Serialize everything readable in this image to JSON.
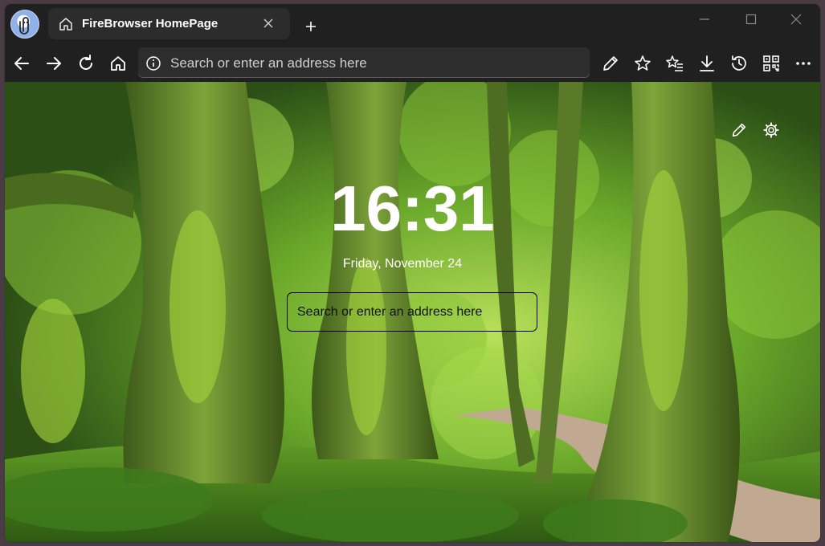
{
  "tab": {
    "title": "FireBrowser HomePage"
  },
  "address_bar": {
    "placeholder": "Search or enter an address here"
  },
  "homepage": {
    "time": "16:31",
    "date": "Friday, November 24",
    "search_placeholder": "Search or enter an address here",
    "background": "moss-covered forest trees with a dirt path"
  },
  "icons": {
    "nav": [
      "back-icon",
      "forward-icon",
      "refresh-icon",
      "home-icon"
    ],
    "toolbar": [
      "pen-icon",
      "star-icon",
      "favorites-list-icon",
      "download-icon",
      "history-icon",
      "qr-code-icon",
      "more-icon"
    ],
    "window": [
      "minimize-icon",
      "maximize-icon",
      "close-icon"
    ]
  },
  "colors": {
    "chrome": "#202020",
    "tab": "#2c2c2c",
    "address_bar": "#2d2d2d",
    "foliage": "#4f8a22",
    "text": "#ffffff"
  }
}
